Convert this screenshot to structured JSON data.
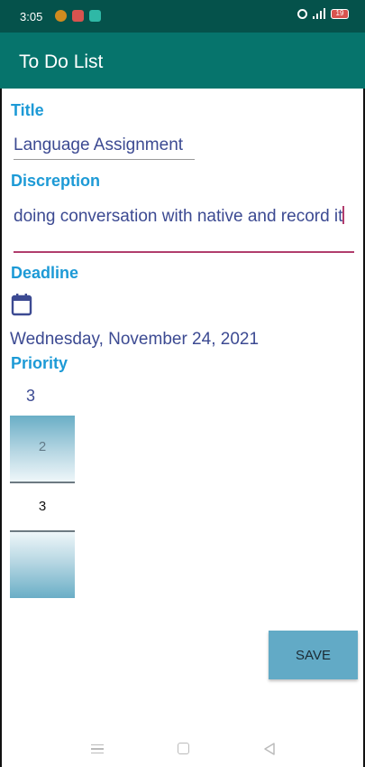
{
  "status_bar": {
    "time": "3:05",
    "battery": "19"
  },
  "app_bar": {
    "title": "To Do List"
  },
  "form": {
    "title_label": "Title",
    "title_value": "Language Assignment",
    "description_label": "Discreption",
    "description_value": "doing conversation with native and record it",
    "deadline_label": "Deadline",
    "deadline_value": "Wednesday, November 24, 2021",
    "priority_label": "Priority",
    "priority_value": "3",
    "picker": {
      "above": "2",
      "selected": "3"
    },
    "save_label": "SAVE"
  },
  "colors": {
    "status_bar": "#05524b",
    "app_bar": "#06746c",
    "label": "#1d9ad6",
    "text": "#3c4a92",
    "accent_underline": "#b13d6d",
    "save_button": "#62aac6"
  }
}
